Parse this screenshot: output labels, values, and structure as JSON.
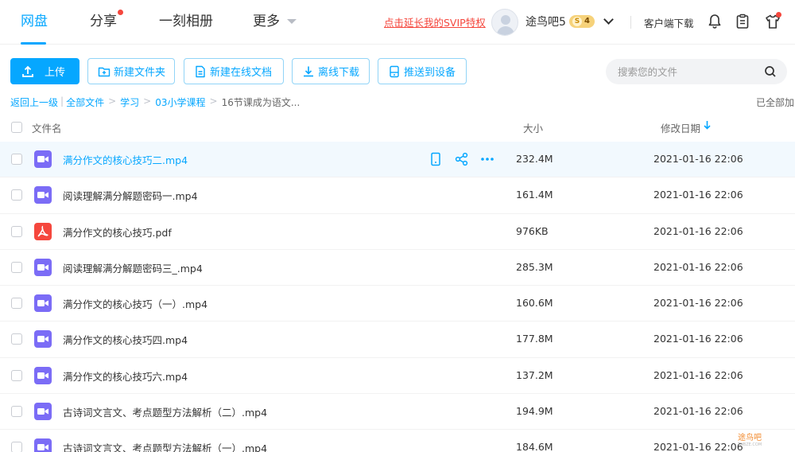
{
  "nav": {
    "items": [
      {
        "label": "网盘",
        "active": true
      },
      {
        "label": "分享",
        "dot": true
      },
      {
        "label": "一刻相册"
      },
      {
        "label": "更多"
      }
    ],
    "svip_link": "点击延长我的SVIP特权",
    "username": "途鸟吧5",
    "vip_level_s": "S",
    "vip_level": "4",
    "client_download": "客户端下载",
    "icons": [
      "bell-icon",
      "clipboard-icon",
      "shirt-icon"
    ]
  },
  "toolbar": {
    "upload": "上传",
    "new_folder": "新建文件夹",
    "new_doc": "新建在线文档",
    "offline_download": "离线下载",
    "push_device": "推送到设备",
    "search_placeholder": "搜索您的文件"
  },
  "breadcrumb": {
    "back": "返回上一级",
    "items": [
      "全部文件",
      "学习",
      "03小学课程",
      "16节课成为语文..."
    ],
    "status": "已全部加"
  },
  "table": {
    "columns": {
      "name": "文件名",
      "size": "大小",
      "modified": "修改日期"
    },
    "rows": [
      {
        "name": "满分作文的核心技巧二.mp4",
        "type": "video",
        "size": "232.4M",
        "date": "2021-01-16 22:06"
      },
      {
        "name": "阅读理解满分解题密码一.mp4",
        "type": "video",
        "size": "161.4M",
        "date": "2021-01-16 22:06"
      },
      {
        "name": "满分作文的核心技巧.pdf",
        "type": "pdf",
        "size": "976KB",
        "date": "2021-01-16 22:06"
      },
      {
        "name": "阅读理解满分解题密码三_.mp4",
        "type": "video",
        "size": "285.3M",
        "date": "2021-01-16 22:06"
      },
      {
        "name": "满分作文的核心技巧（一）.mp4",
        "type": "video",
        "size": "160.6M",
        "date": "2021-01-16 22:06"
      },
      {
        "name": "满分作文的核心技巧四.mp4",
        "type": "video",
        "size": "177.8M",
        "date": "2021-01-16 22:06"
      },
      {
        "name": "满分作文的核心技巧六.mp4",
        "type": "video",
        "size": "137.2M",
        "date": "2021-01-16 22:06"
      },
      {
        "name": "古诗词文言文、考点题型方法解析（二）.mp4",
        "type": "video",
        "size": "194.9M",
        "date": "2021-01-16 22:06"
      },
      {
        "name": "古诗词文言文、考点题型方法解析（一）.mp4",
        "type": "video",
        "size": "184.6M",
        "date": "2021-01-16 22:06"
      }
    ]
  },
  "watermark": {
    "text": "途鸟吧",
    "sub": "TNBZE.COM"
  },
  "colors": {
    "accent": "#06a7ff",
    "video": "#7b6cf6",
    "pdf": "#f5473d",
    "svip": "#f5473d"
  }
}
